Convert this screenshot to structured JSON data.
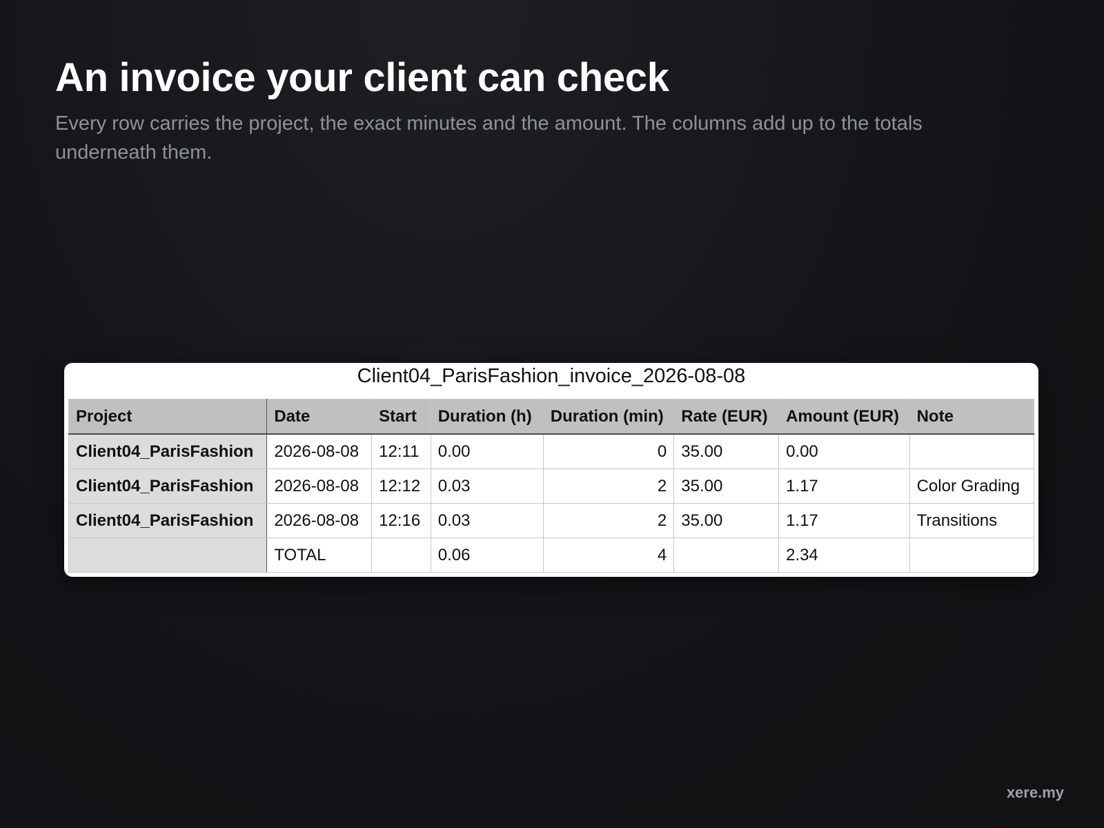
{
  "page": {
    "headline": "An invoice your client can check",
    "subheadline": "Every row carries the project, the exact minutes and the amount. The columns add up to the totals underneath them.",
    "brand": "xere.my"
  },
  "invoice": {
    "title": "Client04_ParisFashion_invoice_2026-08-08",
    "columns": [
      "Project",
      "Date",
      "Start",
      "Duration (h)",
      "Duration (min)",
      "Rate (EUR)",
      "Amount (EUR)",
      "Note"
    ],
    "rows": [
      {
        "project": "Client04_ParisFashion",
        "date": "2026-08-08",
        "start": "12:11",
        "duration_h": "0.00",
        "duration_min": "0",
        "rate": "35.00",
        "amount": "0.00",
        "note": ""
      },
      {
        "project": "Client04_ParisFashion",
        "date": "2026-08-08",
        "start": "12:12",
        "duration_h": "0.03",
        "duration_min": "2",
        "rate": "35.00",
        "amount": "1.17",
        "note": "Color Grading"
      },
      {
        "project": "Client04_ParisFashion",
        "date": "2026-08-08",
        "start": "12:16",
        "duration_h": "0.03",
        "duration_min": "2",
        "rate": "35.00",
        "amount": "1.17",
        "note": "Transitions"
      }
    ],
    "total": {
      "label": "TOTAL",
      "duration_h": "0.06",
      "duration_min": "4",
      "amount": "2.34"
    }
  },
  "colors": {
    "background": "#141518",
    "header_fill": "#bfc1c0",
    "row_header_fill": "#dcdcdc",
    "muted_text": "#8d9299"
  }
}
